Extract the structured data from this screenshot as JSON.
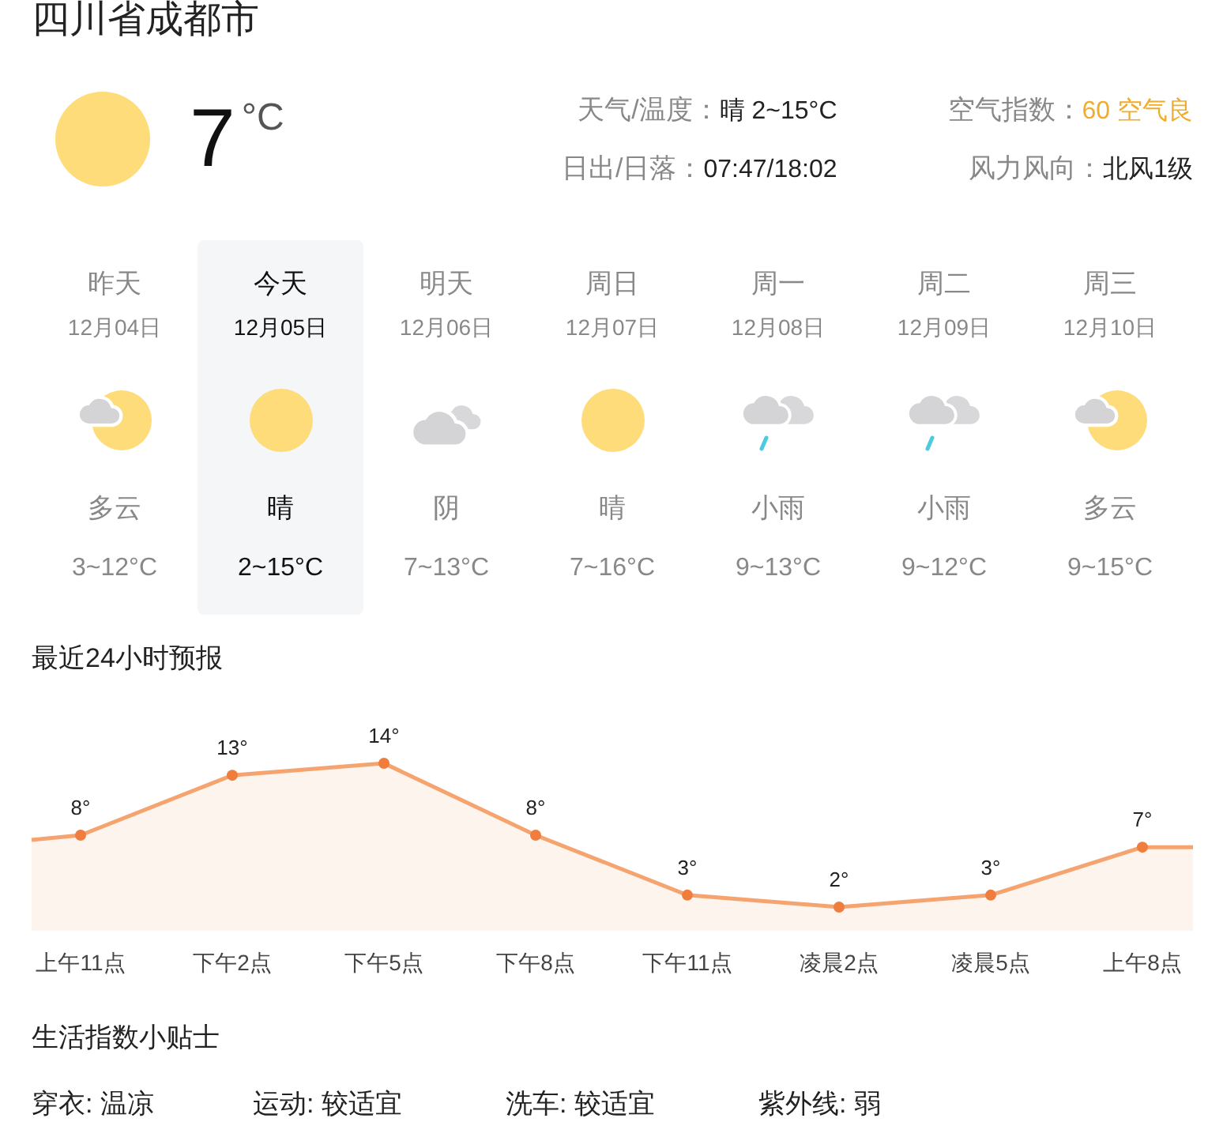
{
  "location": "四川省成都市",
  "current": {
    "kind": "sunny",
    "temperature": "7",
    "unit": "°C"
  },
  "detail_columns": [
    {
      "rows": [
        {
          "label": "天气/温度：",
          "value": "晴 2~15°C",
          "color": "#222222"
        },
        {
          "label": "日出/日落：",
          "value": "07:47/18:02",
          "color": "#222222"
        }
      ]
    },
    {
      "rows": [
        {
          "label": "空气指数：",
          "value": "60 空气良",
          "color": "#f0ac2c"
        },
        {
          "label": "风力风向：",
          "value": "北风1级",
          "color": "#222222"
        }
      ]
    }
  ],
  "days": [
    {
      "name": "昨天",
      "date": "12月04日",
      "kind": "partly-cloudy",
      "condition": "多云",
      "temp": "3~12°C",
      "selected": false
    },
    {
      "name": "今天",
      "date": "12月05日",
      "kind": "sunny",
      "condition": "晴",
      "temp": "2~15°C",
      "selected": true
    },
    {
      "name": "明天",
      "date": "12月06日",
      "kind": "overcast",
      "condition": "阴",
      "temp": "7~13°C",
      "selected": false
    },
    {
      "name": "周日",
      "date": "12月07日",
      "kind": "sunny",
      "condition": "晴",
      "temp": "7~16°C",
      "selected": false
    },
    {
      "name": "周一",
      "date": "12月08日",
      "kind": "rain",
      "condition": "小雨",
      "temp": "9~13°C",
      "selected": false
    },
    {
      "name": "周二",
      "date": "12月09日",
      "kind": "rain",
      "condition": "小雨",
      "temp": "9~12°C",
      "selected": false
    },
    {
      "name": "周三",
      "date": "12月10日",
      "kind": "partly-cloudy",
      "condition": "多云",
      "temp": "9~15°C",
      "selected": false
    }
  ],
  "hourly": {
    "title": "最近24小时预报",
    "chart_data": {
      "type": "area",
      "categories": [
        "上午11点",
        "下午2点",
        "下午5点",
        "下午8点",
        "下午11点",
        "凌晨2点",
        "凌晨5点",
        "上午8点"
      ],
      "series": [
        {
          "color": "#f5a470",
          "values": [
            8,
            13,
            14,
            8,
            3,
            2,
            3,
            7
          ],
          "value_labels": [
            "8°",
            "13°",
            "14°",
            "8°",
            "3°",
            "2°",
            "3°",
            "7°"
          ]
        }
      ]
    }
  },
  "tips": {
    "title": "生活指数小贴士",
    "items": [
      "穿衣: 温凉",
      "运动: 较适宜",
      "洗车: 较适宜",
      "紫外线: 弱"
    ]
  }
}
